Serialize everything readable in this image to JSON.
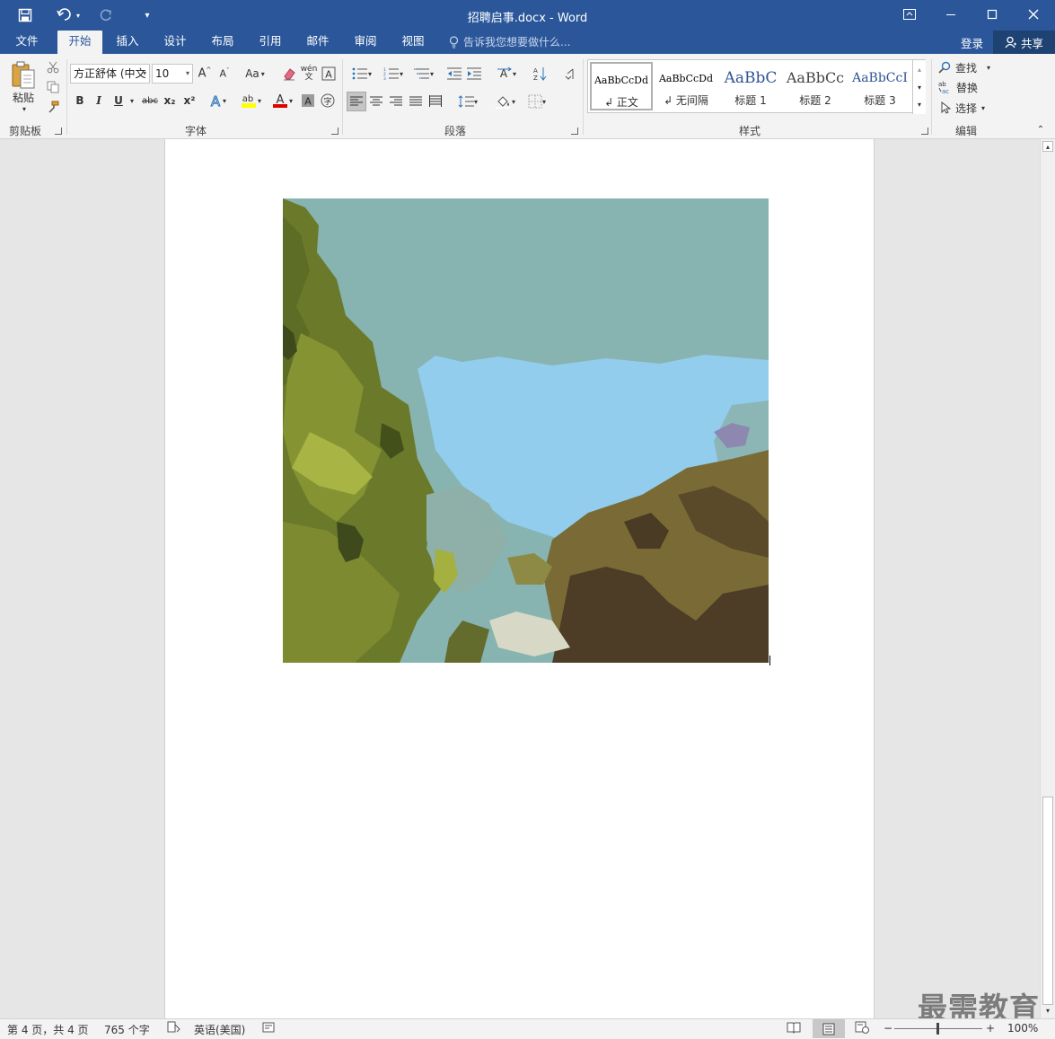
{
  "titlebar": {
    "title": "招聘启事.docx - Word"
  },
  "tabs": [
    {
      "label": "文件",
      "active": false
    },
    {
      "label": "开始",
      "active": true
    },
    {
      "label": "插入",
      "active": false
    },
    {
      "label": "设计",
      "active": false
    },
    {
      "label": "布局",
      "active": false
    },
    {
      "label": "引用",
      "active": false
    },
    {
      "label": "邮件",
      "active": false
    },
    {
      "label": "审阅",
      "active": false
    },
    {
      "label": "视图",
      "active": false
    }
  ],
  "tellme": {
    "placeholder": "告诉我您想要做什么..."
  },
  "account": {
    "login_label": "登录",
    "share_label": "共享"
  },
  "ribbon": {
    "clipboard": {
      "paste_label": "粘贴",
      "group_label": "剪贴板"
    },
    "font": {
      "font_name": "方正舒体 (中文",
      "font_size": "10",
      "change_case_label": "Aa",
      "group_label": "字体",
      "bold": "B",
      "italic": "I",
      "underline": "U",
      "strikethrough": "abc",
      "subscript": "x₂",
      "superscript": "x²"
    },
    "paragraph": {
      "group_label": "段落"
    },
    "styles": {
      "group_label": "样式",
      "items": [
        {
          "sample": "AaBbCcDd",
          "name": "↲ 正文",
          "selected": true
        },
        {
          "sample": "AaBbCcDd",
          "name": "↲ 无间隔",
          "selected": false
        },
        {
          "sample": "AaBbC",
          "name": "标题 1",
          "selected": false
        },
        {
          "sample": "AaBbCc",
          "name": "标题 2",
          "selected": false
        },
        {
          "sample": "AaBbCcI",
          "name": "标题 3",
          "selected": false
        }
      ]
    },
    "editing": {
      "group_label": "编辑",
      "find_label": "查找",
      "replace_label": "替换",
      "select_label": "选择"
    }
  },
  "watermark": {
    "text": "最需教育"
  },
  "statusbar": {
    "page_info": "第 4 页，共 4 页",
    "word_count": "765 个字",
    "language": "英语(美国)",
    "zoom_level": "100%"
  }
}
